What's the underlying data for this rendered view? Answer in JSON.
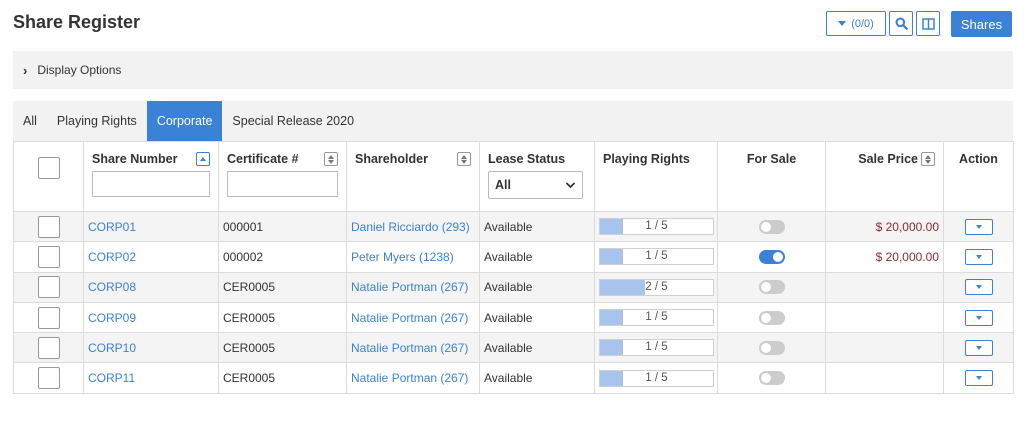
{
  "page_title": "Share Register",
  "toolbar": {
    "filter_count": "(0/0)",
    "shares_label": "Shares"
  },
  "display_options_label": "Display Options",
  "tabs": [
    {
      "label": "All",
      "active": false
    },
    {
      "label": "Playing Rights",
      "active": false
    },
    {
      "label": "Corporate",
      "active": true
    },
    {
      "label": "Special Release 2020",
      "active": false
    }
  ],
  "columns": {
    "share_number": "Share Number",
    "certificate": "Certificate #",
    "shareholder": "Shareholder",
    "lease_status": "Lease Status",
    "lease_status_filter": "All",
    "playing_rights": "Playing Rights",
    "for_sale": "For Sale",
    "sale_price": "Sale Price",
    "action": "Action"
  },
  "rows": [
    {
      "share_number": "CORP01",
      "certificate": "000001",
      "shareholder": "Daniel Ricciardo (293)",
      "lease_status": "Available",
      "playing_rights": "1 / 5",
      "playing_rights_fraction": 0.2,
      "for_sale": false,
      "sale_price": "$ 20,000.00"
    },
    {
      "share_number": "CORP02",
      "certificate": "000002",
      "shareholder": "Peter Myers (1238)",
      "lease_status": "Available",
      "playing_rights": "1 / 5",
      "playing_rights_fraction": 0.2,
      "for_sale": true,
      "sale_price": "$ 20,000.00"
    },
    {
      "share_number": "CORP08",
      "certificate": "CER0005",
      "shareholder": "Natalie Portman (267)",
      "lease_status": "Available",
      "playing_rights": "2 / 5",
      "playing_rights_fraction": 0.4,
      "for_sale": false,
      "sale_price": ""
    },
    {
      "share_number": "CORP09",
      "certificate": "CER0005",
      "shareholder": "Natalie Portman (267)",
      "lease_status": "Available",
      "playing_rights": "1 / 5",
      "playing_rights_fraction": 0.2,
      "for_sale": false,
      "sale_price": ""
    },
    {
      "share_number": "CORP10",
      "certificate": "CER0005",
      "shareholder": "Natalie Portman (267)",
      "lease_status": "Available",
      "playing_rights": "1 / 5",
      "playing_rights_fraction": 0.2,
      "for_sale": false,
      "sale_price": ""
    },
    {
      "share_number": "CORP11",
      "certificate": "CER0005",
      "shareholder": "Natalie Portman (267)",
      "lease_status": "Available",
      "playing_rights": "1 / 5",
      "playing_rights_fraction": 0.2,
      "for_sale": false,
      "sale_price": ""
    }
  ],
  "colors": {
    "accent": "#3b82d6",
    "price": "#8b2d2d",
    "progress_fill": "#a8c4ec",
    "panel_bg": "#f2f2f2"
  }
}
